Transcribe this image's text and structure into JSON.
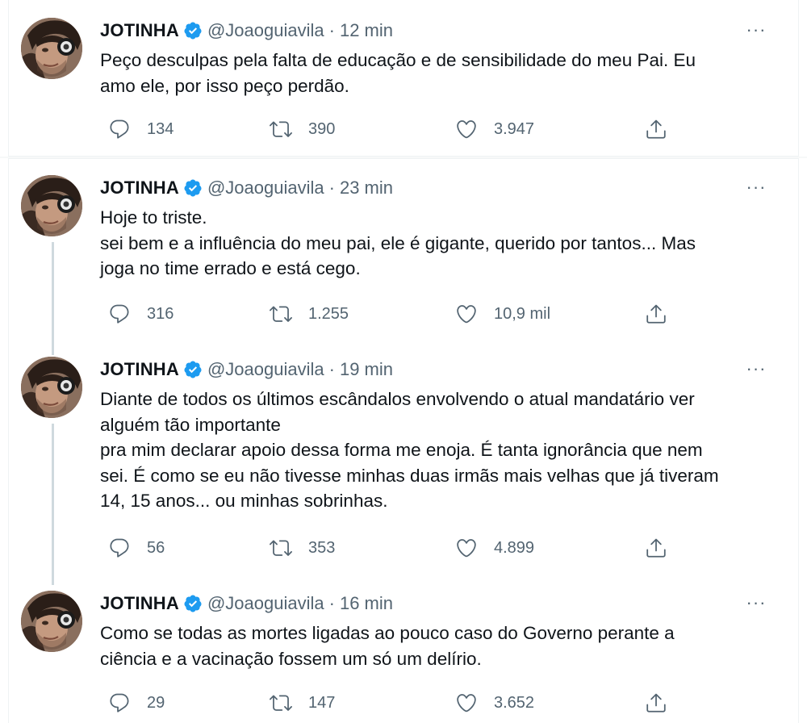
{
  "tweets": [
    {
      "name": "JOTINHA",
      "handle": "@Joaoguiavila",
      "separator": "·",
      "time": "12 min",
      "lines": [
        "Peço desculpas pela falta de educação e de sensibilidade do meu Pai. Eu",
        "amo ele, por isso peço perdão."
      ],
      "replies": "134",
      "retweets": "390",
      "likes": "3.947"
    },
    {
      "name": "JOTINHA",
      "handle": "@Joaoguiavila",
      "separator": "·",
      "time": "23 min",
      "lines": [
        "Hoje to triste.",
        "sei bem e a influência do meu pai, ele é gigante, querido por tantos... Mas",
        "joga no time errado e está cego."
      ],
      "replies": "316",
      "retweets": "1.255",
      "likes": "10,9 mil"
    },
    {
      "name": "JOTINHA",
      "handle": "@Joaoguiavila",
      "separator": "·",
      "time": "19 min",
      "lines": [
        "Diante de todos os últimos escândalos envolvendo o atual mandatário ver",
        "alguém tão importante",
        "pra mim declarar apoio dessa forma  me enoja. É tanta ignorância que nem",
        "sei. É como se eu não tivesse minhas duas irmãs mais velhas que já tiveram",
        "14, 15 anos... ou minhas sobrinhas."
      ],
      "replies": "56",
      "retweets": "353",
      "likes": "4.899"
    },
    {
      "name": "JOTINHA",
      "handle": "@Joaoguiavila",
      "separator": "·",
      "time": "16 min",
      "lines": [
        "Como se todas as mortes ligadas ao pouco caso do Governo perante a",
        "ciência e a vacinação fossem um só um delírio."
      ],
      "replies": "29",
      "retweets": "147",
      "likes": "3.652"
    }
  ],
  "icons": {
    "reply": "reply-icon",
    "retweet": "retweet-icon",
    "like": "like-icon",
    "share": "share-icon",
    "more": "more-icon",
    "verified": "verified-badge-icon"
  },
  "colors": {
    "text": "#0f1419",
    "secondary": "#536471",
    "verified": "#1d9bf0",
    "divider": "#eff3f4",
    "thread_line": "#cfd9de"
  },
  "more_label": "···"
}
